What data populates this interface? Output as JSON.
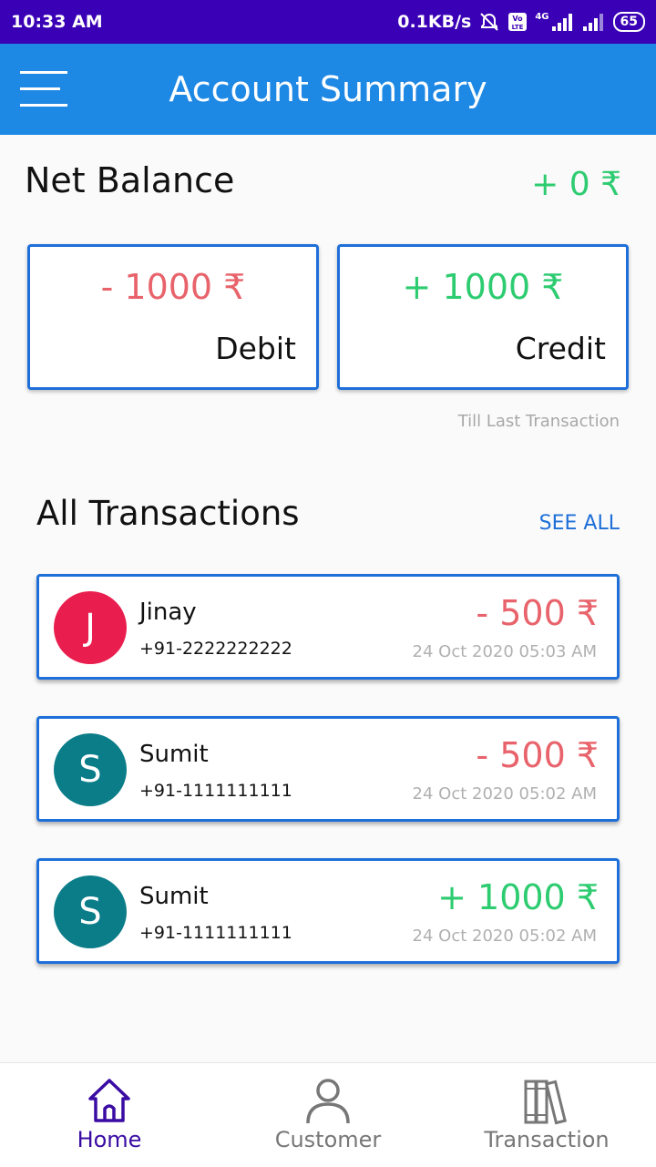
{
  "status_bar": {
    "time": "10:33 AM",
    "net_speed": "0.1KB/s",
    "network_type": "4G",
    "battery": "65",
    "icons": [
      "alarm-off-icon",
      "volte-icon",
      "signal-icon",
      "battery-icon"
    ]
  },
  "app_bar": {
    "title": "Account Summary",
    "menu_icon": "hamburger-menu-icon",
    "color": "#1e88e5"
  },
  "summary": {
    "net_label": "Net Balance",
    "net_value": "+ 0 ₹",
    "debit": {
      "amount": "- 1000 ₹",
      "label": "Debit"
    },
    "credit": {
      "amount": "+ 1000 ₹",
      "label": "Credit"
    },
    "note": "Till Last Transaction"
  },
  "transactions": {
    "title": "All Transactions",
    "see_all": "SEE ALL",
    "items": [
      {
        "initial": "J",
        "name": "Jinay",
        "phone": "+91-2222222222",
        "amount": "- 500 ₹",
        "date": "24 Oct 2020 05:03 AM",
        "avatar_color": "#e91e4e"
      },
      {
        "initial": "S",
        "name": "Sumit",
        "phone": "+91-1111111111",
        "amount": "- 500 ₹",
        "date": "24 Oct 2020 05:02 AM",
        "avatar_color": "#0b7d89"
      },
      {
        "initial": "S",
        "name": "Sumit",
        "phone": "+91-1111111111",
        "amount": "+ 1000 ₹",
        "date": "24 Oct 2020 05:02 AM",
        "avatar_color": "#0b7d89"
      }
    ]
  },
  "bottom_nav": {
    "items": [
      {
        "label": "Home",
        "icon": "home-icon",
        "active": true
      },
      {
        "label": "Customer",
        "icon": "person-icon",
        "active": false
      },
      {
        "label": "Transaction",
        "icon": "books-icon",
        "active": false
      }
    ]
  },
  "colors": {
    "status_bar": "#3a00b6",
    "accent": "#1e6fd9",
    "debit": "#e8636b",
    "credit": "#2ecc71",
    "nav_active": "#3a0ca3"
  }
}
